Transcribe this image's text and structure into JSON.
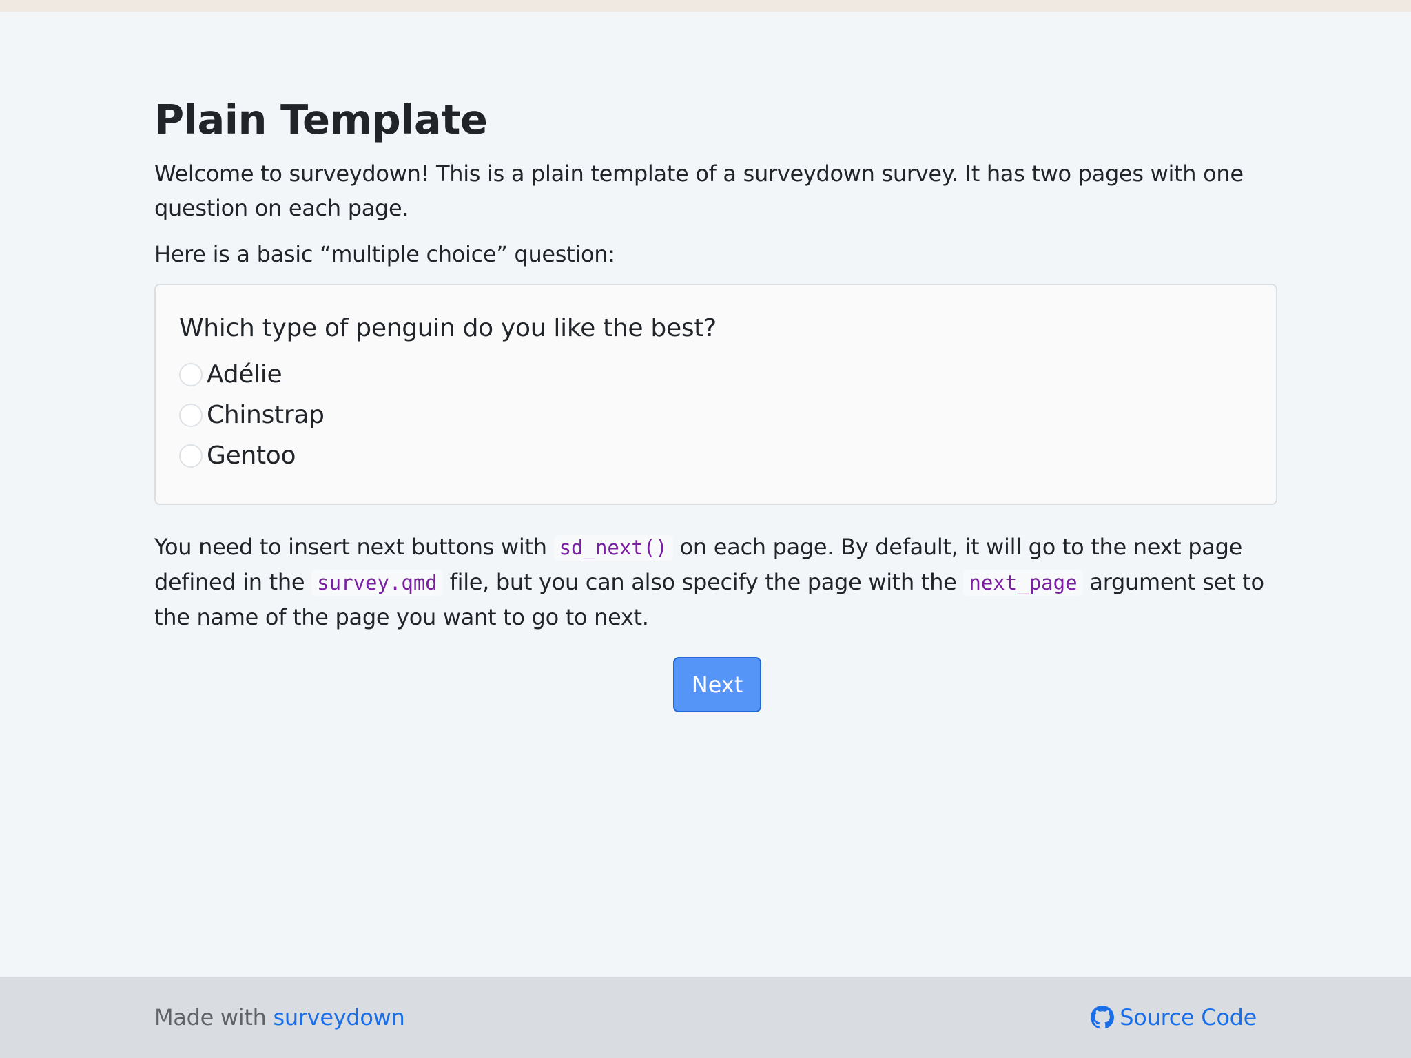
{
  "page": {
    "title": "Plain Template",
    "intro": "Welcome to surveydown! This is a plain template of a surveydown survey. It has two pages with one question on each page.",
    "prompt": "Here is a basic “multiple choice” question:"
  },
  "question": {
    "label": "Which type of penguin do you like the best?",
    "options": [
      {
        "label": "Adélie"
      },
      {
        "label": "Chinstrap"
      },
      {
        "label": "Gentoo"
      }
    ]
  },
  "closing": {
    "t1": "You need to insert next buttons with",
    "code1": "sd_next()",
    "t2": "on each page. By default, it will go to the next page defined in the",
    "code2": "survey.qmd",
    "t3": "file, but you can also specify the page with the",
    "code3": "next_page",
    "t4": "argument set to the name of the page you want to go to next."
  },
  "next_button": {
    "label": "Next"
  },
  "footer": {
    "made_with": "Made with",
    "brand_link": "surveydown",
    "source_link": "Source Code",
    "source_icon": "github-icon"
  },
  "colors": {
    "background": "#f3f6f9",
    "footer_bg": "#d9dce0",
    "accent": "#5595f8",
    "link": "#1a6fe8",
    "code": "#7a1fa2"
  }
}
